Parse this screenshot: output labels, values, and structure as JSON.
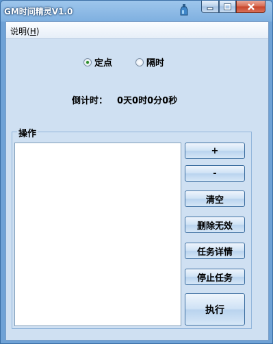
{
  "window": {
    "title": "GM时间精灵V1.0"
  },
  "menu": {
    "items": [
      {
        "label": "说明(",
        "key": "H",
        "suffix": ")"
      }
    ]
  },
  "mode": {
    "options": [
      {
        "label": "定点",
        "checked": true
      },
      {
        "label": "隔时",
        "checked": false
      }
    ]
  },
  "countdown": {
    "label": "倒计时：",
    "value": "0天0时0分0秒"
  },
  "operations": {
    "group_label": "操作",
    "buttons": {
      "add": "+",
      "remove": "-",
      "clear": "清空",
      "delete_invalid": "删除无效",
      "task_details": "任务详情",
      "stop_task": "停止任务",
      "execute": "执行"
    }
  }
}
